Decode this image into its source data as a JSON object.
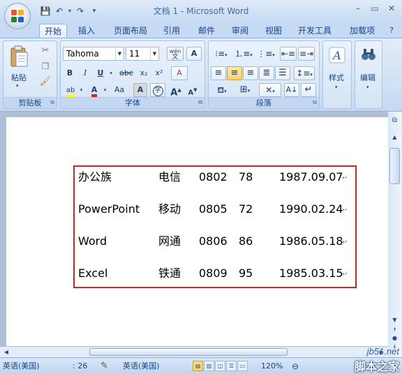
{
  "window": {
    "title": "文档 1 - Microsoft Word"
  },
  "quick_access": {
    "icons": [
      "save-icon",
      "undo-icon",
      "redo-icon",
      "customize-icon"
    ]
  },
  "tabs": [
    {
      "label": "开始",
      "active": true
    },
    {
      "label": "插入"
    },
    {
      "label": "页面布局"
    },
    {
      "label": "引用"
    },
    {
      "label": "邮件"
    },
    {
      "label": "审阅"
    },
    {
      "label": "视图"
    },
    {
      "label": "开发工具"
    },
    {
      "label": "加载项"
    }
  ],
  "ribbon": {
    "clipboard": {
      "label": "剪贴板",
      "paste_label": "粘贴"
    },
    "font": {
      "label": "字体",
      "font_name": "Tahoma",
      "font_size": "11",
      "buttons": {
        "bold": "B",
        "italic": "I",
        "underline": "U",
        "strike": "abc",
        "subscript": "x₂",
        "superscript": "x²",
        "change_case": "Aa",
        "grow": "A",
        "shrink": "A",
        "char_border": "A",
        "phonetic": "wén",
        "clear_format": "A",
        "enclose": "字"
      }
    },
    "paragraph": {
      "label": "段落"
    },
    "styles": {
      "label": "样式"
    },
    "editing": {
      "label": "编辑"
    }
  },
  "document": {
    "rows": [
      {
        "name": "办公族",
        "carrier": "电信",
        "code": "0802",
        "score": "78",
        "date": "1987.09.07"
      },
      {
        "name": "PowerPoint",
        "carrier": "移动",
        "code": "0805",
        "score": "72",
        "date": "1990.02.24"
      },
      {
        "name": "Word",
        "carrier": "网通",
        "code": "0806",
        "score": "86",
        "date": "1986.05.18"
      },
      {
        "name": "Excel",
        "carrier": "铁通",
        "code": "0809",
        "score": "95",
        "date": "1985.03.15"
      }
    ],
    "paragraph_mark": "↵"
  },
  "status_bar": {
    "language": "英语(美国)",
    "word_count": ": 26",
    "language2": "英语(美国)",
    "zoom": "120%"
  },
  "watermark": {
    "site": "jb51.net",
    "name": "脚本之家"
  }
}
